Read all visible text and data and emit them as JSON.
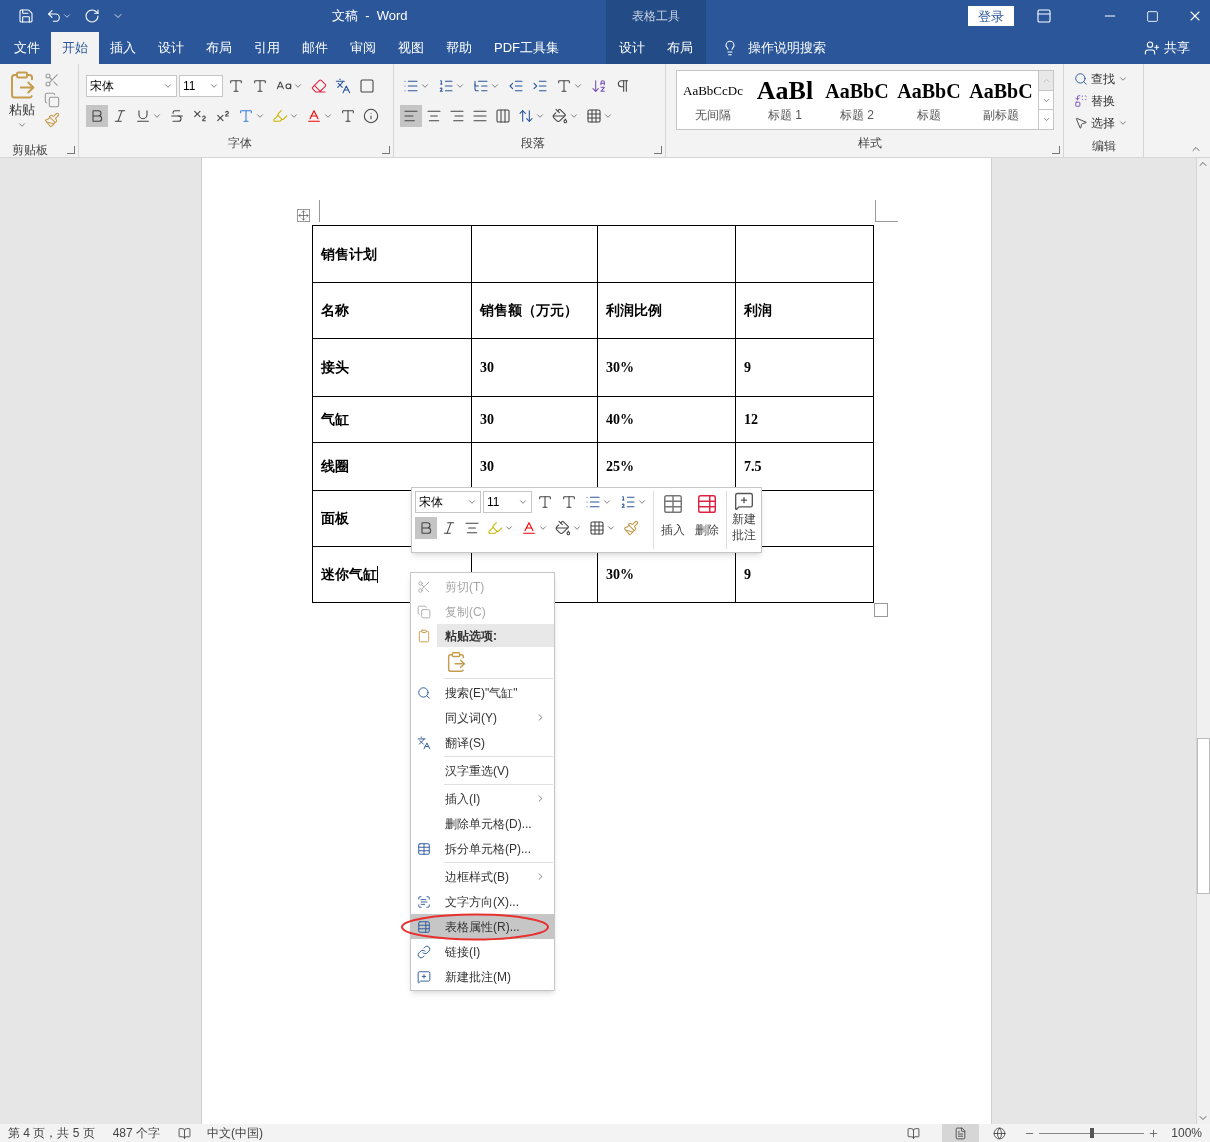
{
  "window": {
    "title": "文稿  -  Word",
    "context_label": "表格工具",
    "login": "登录"
  },
  "tabs": [
    {
      "label": "文件",
      "selected": false,
      "kind": "file"
    },
    {
      "label": "开始",
      "selected": true,
      "kind": "main"
    },
    {
      "label": "插入",
      "selected": false,
      "kind": "main"
    },
    {
      "label": "设计",
      "selected": false,
      "kind": "main"
    },
    {
      "label": "布局",
      "selected": false,
      "kind": "main"
    },
    {
      "label": "引用",
      "selected": false,
      "kind": "main"
    },
    {
      "label": "邮件",
      "selected": false,
      "kind": "main"
    },
    {
      "label": "审阅",
      "selected": false,
      "kind": "main"
    },
    {
      "label": "视图",
      "selected": false,
      "kind": "main"
    },
    {
      "label": "帮助",
      "selected": false,
      "kind": "main"
    },
    {
      "label": "PDF工具集",
      "selected": false,
      "kind": "main"
    },
    {
      "label": "设计",
      "selected": false,
      "kind": "context"
    },
    {
      "label": "布局",
      "selected": false,
      "kind": "context"
    }
  ],
  "tell_me": "操作说明搜索",
  "share": "共享",
  "ribbon": {
    "clipboard": {
      "paste": "粘贴",
      "label": "剪贴板"
    },
    "font": {
      "font_name": "宋体",
      "font_size": "11",
      "bold_active": true,
      "label": "字体"
    },
    "paragraph": {
      "label": "段落",
      "align": [
        {
          "selected": true
        },
        {
          "selected": false
        },
        {
          "selected": false
        },
        {
          "selected": false
        },
        {
          "selected": false
        }
      ]
    },
    "styles": {
      "label": "样式",
      "items": [
        {
          "preview": "AaBbCcDc",
          "name": "无间隔",
          "kind": "normal"
        },
        {
          "preview": "AaBl",
          "name": "标题 1",
          "kind": "heading1"
        },
        {
          "preview": "AaBbC",
          "name": "标题 2",
          "kind": "heading"
        },
        {
          "preview": "AaBbC",
          "name": "标题",
          "kind": "heading"
        },
        {
          "preview": "AaBbC",
          "name": "副标题",
          "kind": "heading"
        }
      ]
    },
    "editing": {
      "find": "查找",
      "replace": "替换",
      "select": "选择",
      "label": "编辑"
    }
  },
  "table": {
    "rows": [
      {
        "cells": [
          "销售计划",
          null,
          null,
          null
        ],
        "has_cursor": false
      },
      {
        "cells": [
          "名称",
          "销售额（万元）",
          "利润比例",
          "利润"
        ],
        "has_cursor": false
      },
      {
        "cells": [
          "接头",
          "30",
          "30%",
          "9"
        ],
        "has_cursor": false
      },
      {
        "cells": [
          "气缸",
          "30",
          "40%",
          "12"
        ],
        "has_cursor": false
      },
      {
        "cells": [
          "线圈",
          "30",
          "25%",
          "7.5"
        ],
        "has_cursor": false
      },
      {
        "cells": [
          "面板",
          null,
          null,
          null
        ],
        "has_cursor": false
      },
      {
        "cells": [
          "迷你气缸",
          null,
          "30%",
          "9"
        ],
        "has_cursor": true
      }
    ]
  },
  "mini_toolbar": {
    "font_name": "宋体",
    "font_size": "11",
    "bold_active": true,
    "insert": "插入",
    "delete": "删除",
    "new_comment": "新建批注"
  },
  "context_menu": [
    {
      "kind": "item",
      "label": "剪切(T)",
      "disabled": true,
      "submenu": false,
      "selected": false,
      "annotated": false
    },
    {
      "kind": "item",
      "label": "复制(C)",
      "disabled": true,
      "submenu": false,
      "selected": false,
      "annotated": false
    },
    {
      "kind": "header",
      "label": "粘贴选项:"
    },
    {
      "kind": "paste_options"
    },
    {
      "kind": "separator"
    },
    {
      "kind": "item",
      "label": "搜索(E)\"气缸\"",
      "disabled": false,
      "submenu": false,
      "selected": false,
      "annotated": false
    },
    {
      "kind": "item",
      "label": "同义词(Y)",
      "disabled": false,
      "submenu": true,
      "selected": false,
      "annotated": false
    },
    {
      "kind": "item",
      "label": "翻译(S)",
      "disabled": false,
      "submenu": false,
      "selected": false,
      "annotated": false
    },
    {
      "kind": "separator"
    },
    {
      "kind": "item",
      "label": "汉字重选(V)",
      "disabled": false,
      "submenu": false,
      "selected": false,
      "annotated": false
    },
    {
      "kind": "separator"
    },
    {
      "kind": "item",
      "label": "插入(I)",
      "disabled": false,
      "submenu": true,
      "selected": false,
      "annotated": false
    },
    {
      "kind": "item",
      "label": "删除单元格(D)...",
      "disabled": false,
      "submenu": false,
      "selected": false,
      "annotated": false
    },
    {
      "kind": "item",
      "label": "拆分单元格(P)...",
      "disabled": false,
      "submenu": false,
      "selected": false,
      "annotated": false
    },
    {
      "kind": "separator"
    },
    {
      "kind": "item",
      "label": "边框样式(B)",
      "disabled": false,
      "submenu": true,
      "selected": false,
      "annotated": false
    },
    {
      "kind": "item",
      "label": "文字方向(X)...",
      "disabled": false,
      "submenu": false,
      "selected": false,
      "annotated": false
    },
    {
      "kind": "item",
      "label": "表格属性(R)...",
      "disabled": false,
      "submenu": false,
      "selected": true,
      "annotated": true
    },
    {
      "kind": "item",
      "label": "链接(I)",
      "disabled": false,
      "submenu": false,
      "selected": false,
      "annotated": false
    },
    {
      "kind": "item",
      "label": "新建批注(M)",
      "disabled": false,
      "submenu": false,
      "selected": false,
      "annotated": false
    }
  ],
  "status_bar": {
    "page": "第 4 页，共 5 页",
    "words": "487 个字",
    "language": "中文(中国)",
    "zoom": "100%",
    "zoom_level": {
      "level": 0.5
    }
  }
}
